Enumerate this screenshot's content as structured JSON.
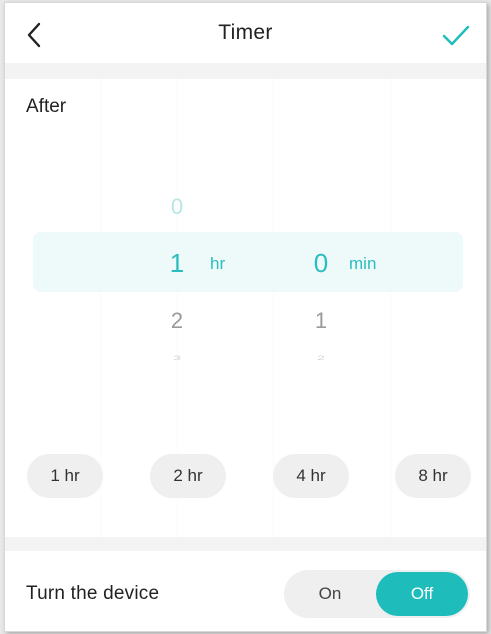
{
  "header": {
    "title": "Timer",
    "back_icon": "chevron-left-icon",
    "confirm_icon": "check-icon"
  },
  "picker": {
    "label": "After",
    "hours": {
      "above": "0",
      "selected": "1",
      "below": "2",
      "below2": "3",
      "unit": "hr"
    },
    "minutes": {
      "selected": "0",
      "below": "1",
      "below2": "2",
      "unit": "min"
    }
  },
  "presets": [
    "1 hr",
    "2 hr",
    "4 hr",
    "8 hr"
  ],
  "action": {
    "label": "Turn the device",
    "options": [
      "On",
      "Off"
    ],
    "selected": "Off"
  },
  "colors": {
    "accent": "#1fbcbc",
    "selected_band": "#eef9fa"
  }
}
